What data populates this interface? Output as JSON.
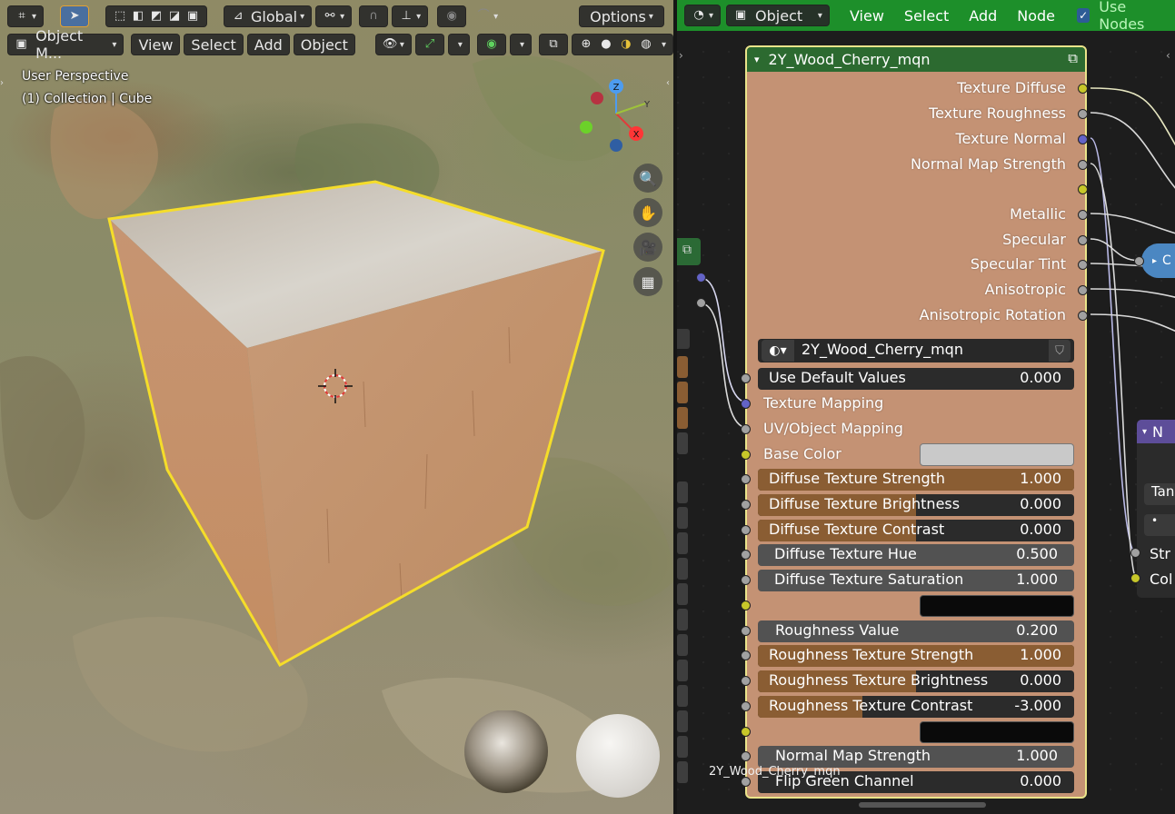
{
  "viewport": {
    "header1": {
      "orientation_label": "Global",
      "options_label": "Options"
    },
    "header2": {
      "mode_label": "Object M...",
      "menus": [
        "View",
        "Select",
        "Add",
        "Object"
      ]
    },
    "overlay": {
      "perspective": "User Perspective",
      "collection": "(1) Collection | Cube"
    },
    "gizmo": {
      "x": "X",
      "y": "Y",
      "z": "Z"
    }
  },
  "node_editor": {
    "header": {
      "object_label": "Object",
      "menus": [
        "View",
        "Select",
        "Add",
        "Node"
      ],
      "use_nodes_label": "Use Nodes"
    },
    "group_node": {
      "title": "2Y_Wood_Cherry_mqn",
      "datablock": "2Y_Wood_Cherry_mqn",
      "outputs": [
        "Texture Diffuse",
        "Texture Roughness",
        "Texture Normal",
        "Normal Map Strength",
        "Metallic",
        "Specular",
        "Specular Tint",
        "Anisotropic",
        "Anisotropic Rotation"
      ],
      "socket_inputs": {
        "texture_mapping": "Texture Mapping",
        "uv_mapping": "UV/Object Mapping",
        "base_color": "Base Color"
      },
      "fields": [
        {
          "label": "Use Default Values",
          "value": "0.000"
        },
        {
          "label": "Diffuse Texture Strength",
          "value": "1.000"
        },
        {
          "label": "Diffuse Texture Brightness",
          "value": "0.000"
        },
        {
          "label": "Diffuse Texture Contrast",
          "value": "0.000"
        },
        {
          "label": "Diffuse Texture Hue",
          "value": "0.500"
        },
        {
          "label": "Diffuse Texture Saturation",
          "value": "1.000"
        },
        {
          "label": "Roughness Value",
          "value": "0.200"
        },
        {
          "label": "Roughness Texture Strength",
          "value": "1.000"
        },
        {
          "label": "Roughness Texture Brightness",
          "value": "0.000"
        },
        {
          "label": "Roughness Texture Contrast",
          "value": "-3.000"
        },
        {
          "label": "Normal Map Strength",
          "value": "1.000"
        },
        {
          "label": "Flip Green Channel",
          "value": "0.000"
        }
      ]
    },
    "frame_label": "2Y_Wood_Cherry_mqn",
    "right_node": {
      "title_fragment": "N",
      "field_fragment": "Tan",
      "socket_labels": [
        "Str",
        "Col"
      ]
    },
    "reroute_fragment": "C"
  },
  "colors": {
    "node_header_green": "#2c6a30",
    "node_body": "#c49274",
    "selection_outline": "#eae48a",
    "editor_header_green": "#1d8f2a",
    "slider_fill": "#8a5d33",
    "socket_yellow": "#c7c729",
    "socket_grey": "#a1a1a1",
    "socket_blue": "#6363c7"
  }
}
